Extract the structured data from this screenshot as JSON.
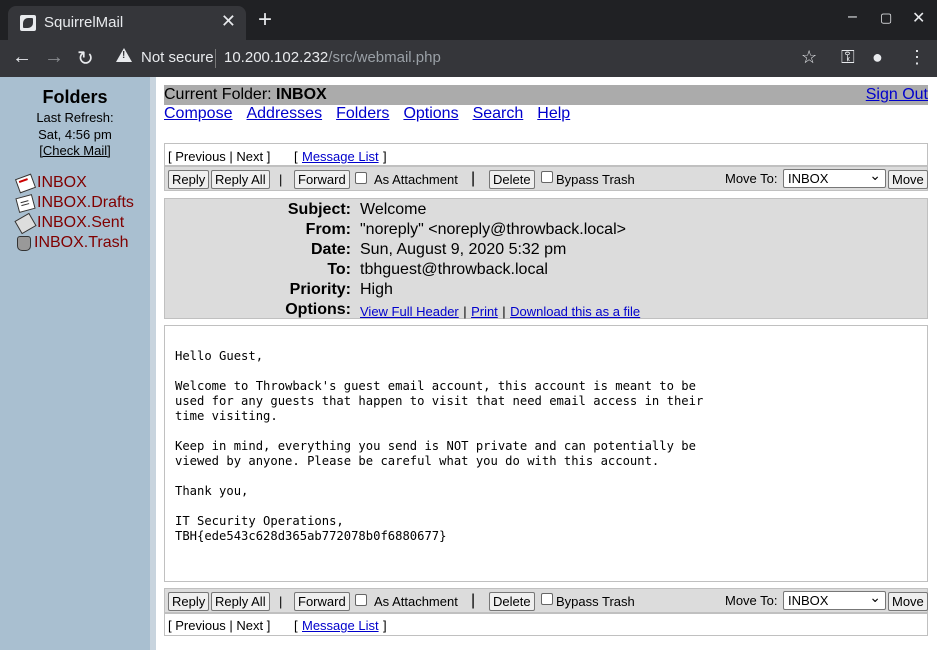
{
  "browser": {
    "tab_title": "SquirrelMail",
    "security_label": "Not secure",
    "url_host": "10.200.102.232",
    "url_path": "/src/webmail.php"
  },
  "left": {
    "folders_title": "Folders",
    "last_refresh_label": "Last Refresh:",
    "last_refresh_time": "Sat, 4:56 pm",
    "check_mail": "[Check Mail]",
    "folders": [
      {
        "name": "INBOX",
        "icon": "inbox-icon"
      },
      {
        "name": "INBOX.Drafts",
        "icon": "drafts-icon"
      },
      {
        "name": "INBOX.Sent",
        "icon": "sent-icon"
      },
      {
        "name": "INBOX.Trash",
        "icon": "trash-icon"
      }
    ]
  },
  "header": {
    "current_folder_label": "Current Folder:",
    "current_folder": "INBOX",
    "sign_out": "Sign Out",
    "nav": [
      "Compose",
      "Addresses",
      "Folders",
      "Options",
      "Search",
      "Help"
    ]
  },
  "message_nav": {
    "prev_next": "[ Previous | Next ]",
    "message_list": "Message List",
    "open_bracket": "[",
    "close_bracket": "]"
  },
  "actions": {
    "reply": "Reply",
    "reply_all": "Reply All",
    "forward": "Forward",
    "as_attachment": "As Attachment",
    "delete": "Delete",
    "bypass_trash": "Bypass Trash",
    "move_to_label": "Move To:",
    "move_to_value": "INBOX",
    "move": "Move",
    "pipe": "|"
  },
  "message": {
    "subject_label": "Subject:",
    "subject": "Welcome",
    "from_label": "From:",
    "from": "\"noreply\" <noreply@throwback.local>",
    "date_label": "Date:",
    "date": "Sun, August 9, 2020 5:32 pm",
    "to_label": "To:",
    "to": "tbhguest@throwback.local",
    "priority_label": "Priority:",
    "priority": "High",
    "options_label": "Options:",
    "view_full_header": "View Full Header",
    "print": "Print",
    "download": "Download this as a file",
    "body": "Hello Guest,\n\nWelcome to Throwback's guest email account, this account is meant to be\nused for any guests that happen to visit that need email access in their\ntime visiting.\n\nKeep in mind, everything you send is NOT private and can potentially be\nviewed by anyone. Please be careful what you do with this account.\n\nThank you,\n\nIT Security Operations,\nTBH{ede543c628d365ab772078b0f6880677}"
  }
}
